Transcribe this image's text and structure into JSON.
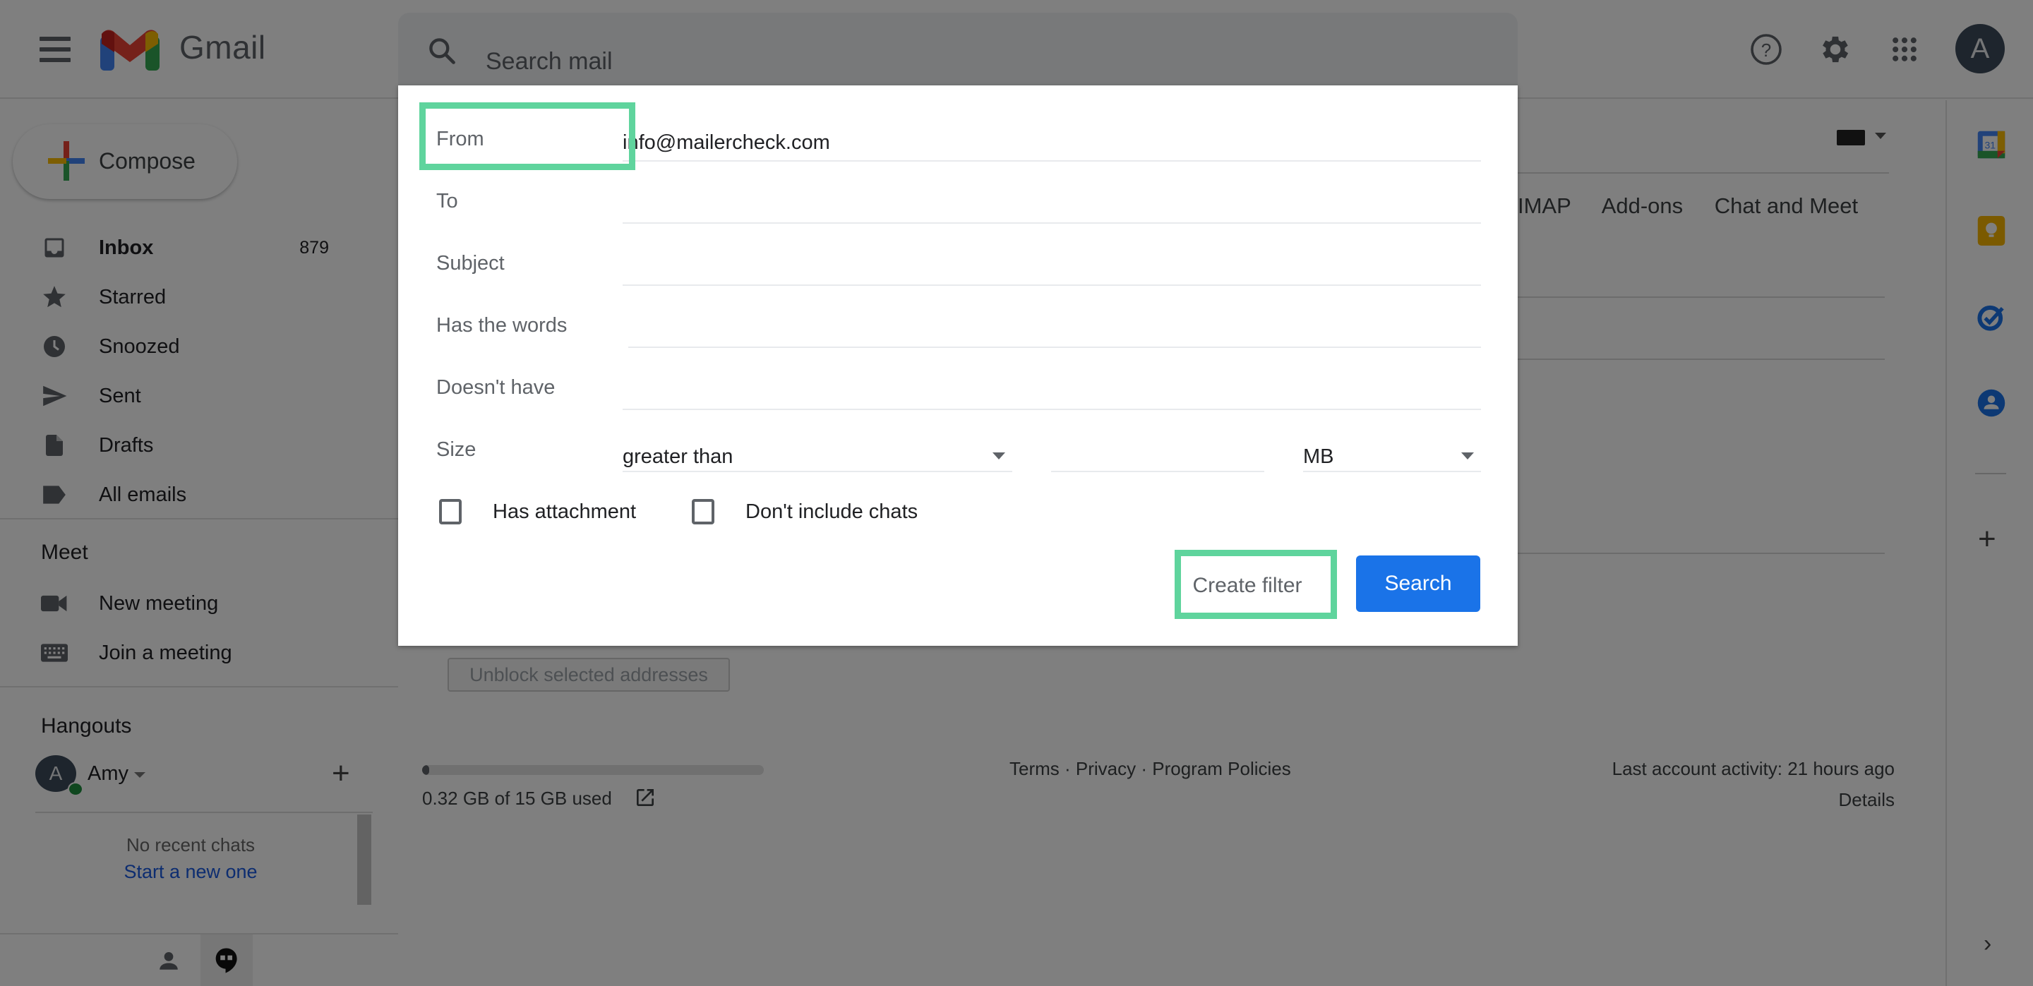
{
  "header": {
    "app_name": "Gmail",
    "search_placeholder": "Search mail",
    "avatar_initial": "A",
    "icons": [
      "menu-icon",
      "help-icon",
      "settings-icon",
      "apps-icon"
    ]
  },
  "sidebar": {
    "compose_label": "Compose",
    "items": [
      {
        "label": "Inbox",
        "count": "879",
        "icon": "inbox-icon",
        "bold": true
      },
      {
        "label": "Starred",
        "count": "",
        "icon": "star-icon"
      },
      {
        "label": "Snoozed",
        "count": "",
        "icon": "clock-icon"
      },
      {
        "label": "Sent",
        "count": "",
        "icon": "send-icon"
      },
      {
        "label": "Drafts",
        "count": "",
        "icon": "draft-icon"
      },
      {
        "label": "All emails",
        "count": "",
        "icon": "label-icon"
      }
    ],
    "meet": {
      "title": "Meet",
      "items": [
        {
          "label": "New meeting",
          "icon": "video-camera-icon"
        },
        {
          "label": "Join a meeting",
          "icon": "keyboard-icon"
        }
      ]
    },
    "hangouts": {
      "title": "Hangouts",
      "user_initial": "A",
      "user_name": "Amy",
      "no_chats": "No recent chats",
      "start_new": "Start a new one"
    }
  },
  "main": {
    "settings_tabs": [
      "IMAP",
      "Add-ons",
      "Chat and Meet"
    ],
    "unblock_label": "Unblock selected addresses",
    "storage": {
      "text": "0.32 GB of 15 GB used",
      "used_fraction": 0.021
    },
    "footer_links": [
      "Terms",
      "Privacy",
      "Program Policies"
    ],
    "footer_separator": " · ",
    "last_activity": "Last account activity: 21 hours ago",
    "details": "Details"
  },
  "right_panel": {
    "apps": [
      "calendar-icon",
      "keep-icon",
      "tasks-icon",
      "contacts-icon"
    ],
    "colors": {
      "calendar_blue": "#4285f4",
      "keep_yellow": "#f6b400",
      "tasks_blue": "#1a73e8",
      "contacts_blue": "#1a73e8"
    }
  },
  "dialog": {
    "fields": {
      "from": {
        "label": "From",
        "value": "info@mailercheck.com"
      },
      "to": {
        "label": "To",
        "value": ""
      },
      "subject": {
        "label": "Subject",
        "value": ""
      },
      "has_words": {
        "label": "Has the words",
        "value": ""
      },
      "doesnt_have": {
        "label": "Doesn't have",
        "value": ""
      }
    },
    "size": {
      "label": "Size",
      "comparator": "greater than",
      "amount": "",
      "unit": "MB"
    },
    "checkboxes": {
      "has_attachment": {
        "label": "Has attachment",
        "checked": false
      },
      "dont_include_chats": {
        "label": "Don't include chats",
        "checked": false
      }
    },
    "buttons": {
      "create_filter": "Create filter",
      "search": "Search"
    },
    "highlight_color": "#5fd49d",
    "primary_color": "#1a73e8"
  }
}
